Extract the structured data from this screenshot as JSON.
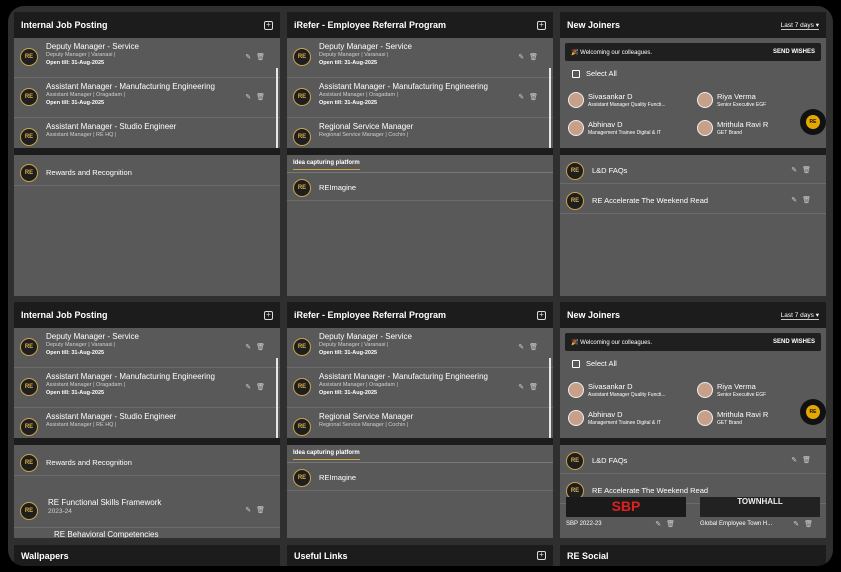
{
  "panels": {
    "ijp_title": "Internal Job Posting",
    "irefer_title": "iRefer - Employee Referral Program",
    "nj_title": "New Joiners",
    "last_days": "Last 7 days",
    "logo_text": "RE"
  },
  "jobs": [
    {
      "title": "Deputy Manager - Service",
      "sub": "Deputy Manager | Varanasi |",
      "date": "Open till: 31-Aug-2025"
    },
    {
      "title": "Assistant Manager - Manufacturing Engineering",
      "sub": "Assistant Manager | Oragadam |",
      "date": "Open till: 31-Aug-2025"
    },
    {
      "title": "Assistant Manager - Studio Engineer",
      "sub": "Assistant Manager | RE HQ |",
      "date": ""
    }
  ],
  "irefer_jobs": [
    {
      "title": "Deputy Manager - Service",
      "sub": "Deputy Manager | Varanasi |",
      "date": "Open till: 31-Aug-2025"
    },
    {
      "title": "Assistant Manager - Manufacturing Engineering",
      "sub": "Assistant Manager | Oragadam |",
      "date": "Open till: 31-Aug-2025"
    },
    {
      "title": "Regional Service Manager",
      "sub": "Regional Service Manager | Cochin |",
      "date": ""
    }
  ],
  "rewards": "Rewards and Recognition",
  "idea_tab": "Idea capturing platform",
  "reimagine": "REImagine",
  "newjoiners": {
    "welcome": "Welcoming our colleagues.",
    "send": "SEND WISHES",
    "select_all": "Select All",
    "people": [
      {
        "name": "Sivasankar D",
        "role": "Assistant Manager Quality Functi..."
      },
      {
        "name": "Riya Verma",
        "role": "Senior Executive EGF"
      },
      {
        "name": "Abhinav D",
        "role": "Management Trainee Digital & IT"
      },
      {
        "name": "Mrithula Ravi R",
        "role": "GET Brand"
      }
    ]
  },
  "ld": {
    "faqs": "L&D FAQs",
    "accelerate": "RE Accelerate The Weekend Read"
  },
  "frameworks": {
    "functional": "RE Functional Skills Framework",
    "year": "2023-24",
    "behavioral": "RE Behavioral Competencies"
  },
  "banners": {
    "sbp": "SBP 2022-23",
    "townhall": "Global Employee Town H...",
    "sbp_art": "SBP",
    "townhall_art": "TOWNHALL"
  },
  "bottom": {
    "wallpapers": "Wallpapers",
    "useful": "Useful Links",
    "social": "RE Social"
  },
  "icons": {
    "edit": "pencil-icon",
    "delete": "trash-icon",
    "add": "plus-square-icon",
    "celebrate": "party-popper-icon"
  }
}
